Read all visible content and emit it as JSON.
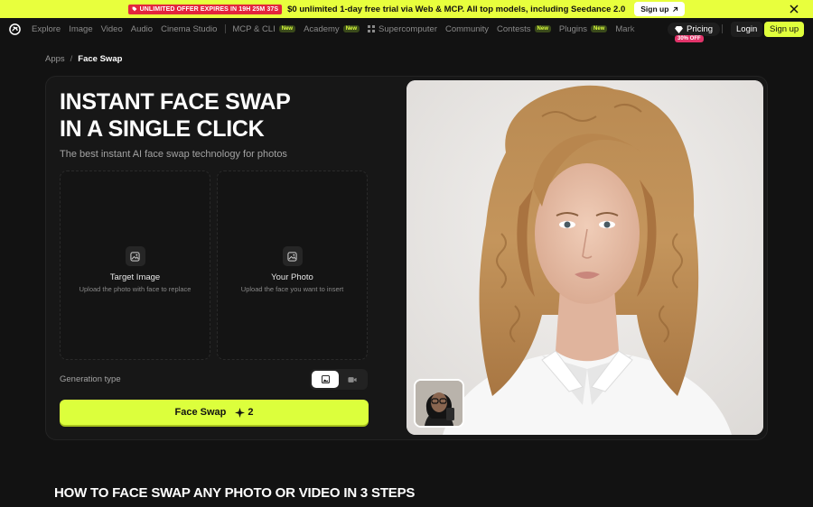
{
  "promo": {
    "badge": "UNLIMITED OFFER EXPIRES IN 19H 25M 37S",
    "text": "$0 unlimited 1-day free trial via Web & MCP. All top models, including Seedance 2.0",
    "signup_label": "Sign up"
  },
  "nav": {
    "items": [
      {
        "label": "Explore"
      },
      {
        "label": "Image"
      },
      {
        "label": "Video"
      },
      {
        "label": "Audio"
      },
      {
        "label": "Cinema Studio"
      },
      {
        "label": "MCP & CLI",
        "badge": "New"
      },
      {
        "label": "Academy",
        "badge": "New"
      },
      {
        "label": "Supercomputer"
      },
      {
        "label": "Community"
      },
      {
        "label": "Contests",
        "badge": "New"
      },
      {
        "label": "Plugins",
        "badge": "New"
      },
      {
        "label": "Mark"
      }
    ],
    "pricing_label": "Pricing",
    "pricing_badge": "30% OFF",
    "login_label": "Login",
    "signup_label": "Sign up"
  },
  "breadcrumb": {
    "apps": "Apps",
    "separator": "/",
    "current": "Face Swap"
  },
  "hero": {
    "headline_line1": "INSTANT FACE SWAP",
    "headline_line2": "IN A SINGLE CLICK",
    "subtitle": "The best instant AI face swap technology for photos"
  },
  "uploads": {
    "target_title": "Target Image",
    "target_desc": "Upload the photo with face to replace",
    "yours_title": "Your Photo",
    "yours_desc": "Upload the face you want to insert"
  },
  "generation": {
    "label": "Generation type",
    "active": "image"
  },
  "cta": {
    "label": "Face Swap",
    "cost": "2"
  },
  "section": {
    "title": "HOW TO FACE SWAP ANY PHOTO OR VIDEO IN 3 STEPS"
  },
  "colors": {
    "accent": "#dcff3c",
    "promo_bg": "#e8ff3d",
    "badge_red": "#e3253d",
    "background": "#121212"
  }
}
